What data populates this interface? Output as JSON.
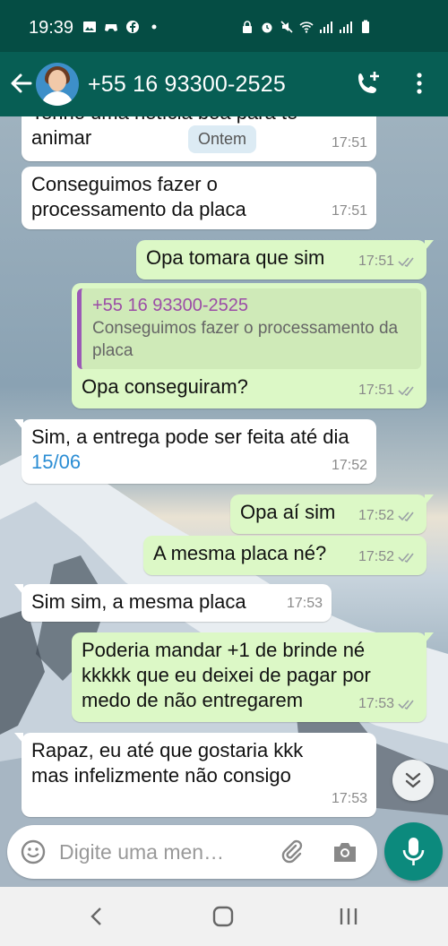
{
  "status_bar": {
    "time": "19:39"
  },
  "header": {
    "contact": "+55 16 93300-2525"
  },
  "date_pill": "Ontem",
  "messages": [
    {
      "dir": "in",
      "text": "Tenho uma notícia boa para te animar",
      "time": "17:51"
    },
    {
      "dir": "in",
      "text": "Conseguimos fazer o processamento da placa",
      "time": "17:51"
    },
    {
      "dir": "out",
      "text": "Opa tomara que sim",
      "time": "17:51"
    },
    {
      "dir": "out",
      "quote_author": "+55 16 93300-2525",
      "quote_text": "Conseguimos fazer o processamento da placa",
      "text": "Opa conseguiram?",
      "time": "17:51"
    },
    {
      "dir": "in",
      "text_before": "Sim, a entrega pode ser feita até dia ",
      "date_link": "15/06",
      "time": "17:52"
    },
    {
      "dir": "out",
      "text": "Opa aí sim",
      "time": "17:52"
    },
    {
      "dir": "out",
      "text": "A mesma placa né?",
      "time": "17:52"
    },
    {
      "dir": "in",
      "text": "Sim sim, a mesma placa",
      "time": "17:53"
    },
    {
      "dir": "out",
      "text": "Poderia mandar +1 de brinde né kkkkk que eu deixei de pagar por medo de não entregarem",
      "time": "17:53"
    },
    {
      "dir": "in",
      "text": "Rapaz, eu até que gostaria kkk mas infelizmente não consigo",
      "time": "17:53"
    }
  ],
  "input": {
    "placeholder": "Digite uma men…"
  },
  "colors": {
    "header": "#075e54",
    "outgoing": "#dcf8c6",
    "incoming": "#ffffff",
    "accent": "#0c8a7d"
  },
  "icons": [
    "back-arrow-icon",
    "add-call-icon",
    "more-vert-icon",
    "emoji-icon",
    "attach-icon",
    "camera-icon",
    "mic-icon",
    "chevron-double-down-icon"
  ]
}
